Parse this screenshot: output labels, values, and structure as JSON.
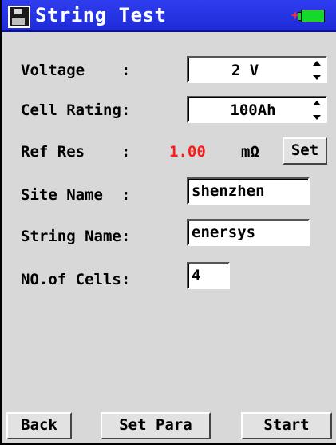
{
  "window": {
    "title": "String Test",
    "icon": "floppy-disk-icon",
    "battery_icon": "battery-charging-icon",
    "battery_plus": "+"
  },
  "form": {
    "voltage": {
      "label": "Voltage    :",
      "value": "2 V"
    },
    "cell_rating": {
      "label": "Cell Rating:",
      "value": "100Ah"
    },
    "ref_res": {
      "label": "Ref Res    :",
      "value": "1.00",
      "unit": "mΩ",
      "set_label": "Set",
      "value_color": "#ff1a1a"
    },
    "site_name": {
      "label": "Site Name  :",
      "value": "shenzhen"
    },
    "string_name": {
      "label": "String Name:",
      "value": "enersys"
    },
    "num_cells": {
      "label": "NO.of Cells:",
      "value": "4"
    }
  },
  "footer": {
    "back_label": "Back",
    "set_para_label": "Set Para",
    "start_label": "Start"
  },
  "colors": {
    "titlebar": "#1e2bd6",
    "background": "#d8d8d8",
    "battery": "#14d92b"
  }
}
